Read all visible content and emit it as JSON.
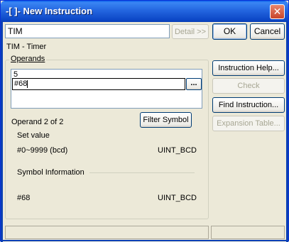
{
  "window": {
    "title": "-[ ]- New Instruction",
    "close_glyph": "✕"
  },
  "instruction_input": {
    "value": "TIM"
  },
  "buttons": {
    "detail": "Detail >>",
    "ok": "OK",
    "cancel": "Cancel",
    "instruction_help": "Instruction Help...",
    "check": "Check",
    "find_instruction": "Find Instruction...",
    "expansion_table": "Expansion Table...",
    "filter_symbol": "Filter Symbol",
    "browse": "..."
  },
  "instruction_desc": "TIM - Timer",
  "operands": {
    "legend": "Operands",
    "items": [
      "5",
      "#68"
    ],
    "position": "Operand 2 of 2",
    "set_value_label": "Set value",
    "set_value_range": "#0~9999 (bcd)",
    "set_value_type": "UINT_BCD",
    "symbol_info_label": "Symbol Information",
    "symbol_name": "#68",
    "symbol_type": "UINT_BCD"
  }
}
